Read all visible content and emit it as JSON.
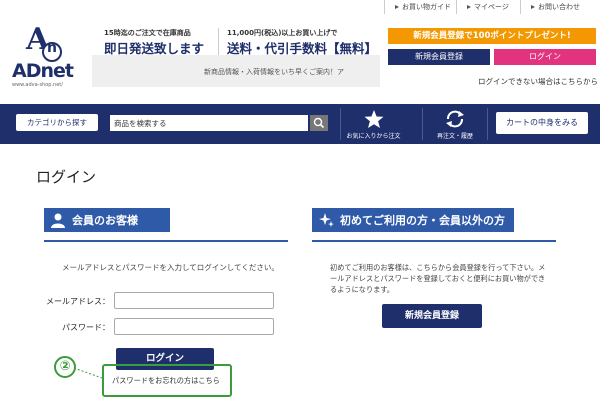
{
  "header": {
    "logo_text": "ADnet",
    "logo_url": "www.adva-shop.net/",
    "promo1_small": "15時迄のご注文で在庫商品",
    "promo1_big": "即日発送致します",
    "promo2_small": "11,000円(税込)以上お買い上げで",
    "promo2_big": "送料・代引手数料【無料】",
    "notice": "新商品情報・入荷情報をいち早くご案内！ア",
    "top_links": [
      "お買い物ガイド",
      "マイページ",
      "お問い合わせ"
    ],
    "point_banner": "新規会員登録で100ポイントプレゼント!",
    "register_label": "新規会員登録",
    "login_label": "ログイン",
    "forgot_top": "ログインできない場合はこちらから"
  },
  "nav": {
    "category_btn": "カテゴリから探す",
    "search_placeholder": "商品を検索する",
    "favorites_label": "お気に入りから注文",
    "reorder_label": "再注文・履歴",
    "cart_btn": "カートの中身をみる"
  },
  "main": {
    "title": "ログイン",
    "member": {
      "heading": "会員のお客様",
      "desc": "メールアドレスとパスワードを入力してログインしてください。",
      "email_label": "メールアドレス：",
      "password_label": "パスワード：",
      "login_btn": "ログイン",
      "forgot_link": "パスワードをお忘れの方はこちら"
    },
    "guest": {
      "heading": "初めてご利用の方・会員以外の方",
      "desc": "初めてご利用のお客様は、こちらから会員登録を行って下さい。メールアドレスとパスワードを登録しておくと便利にお買い物ができるようになります。",
      "register_btn": "新規会員登録"
    }
  },
  "annotation": {
    "number": "②"
  },
  "colors": {
    "navy": "#1e2f6b",
    "blue": "#2e5aa8",
    "orange": "#f39800",
    "pink": "#e2337f",
    "green": "#3a9c3a"
  }
}
